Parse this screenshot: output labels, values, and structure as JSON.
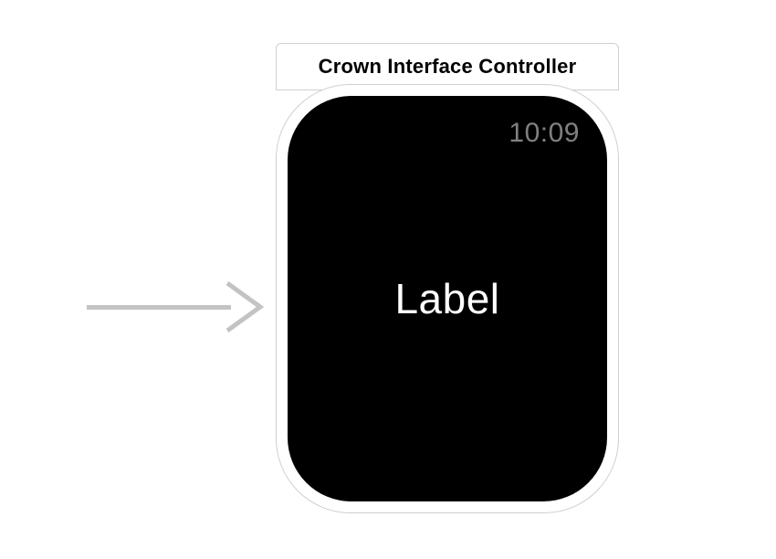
{
  "controller": {
    "title": "Crown Interface Controller"
  },
  "watch": {
    "time": "10:09",
    "label": "Label"
  },
  "colors": {
    "arrow": "#c3c3c3",
    "border": "#d0d0d0",
    "screen": "#000000",
    "time": "#808080",
    "label": "#ffffff"
  }
}
